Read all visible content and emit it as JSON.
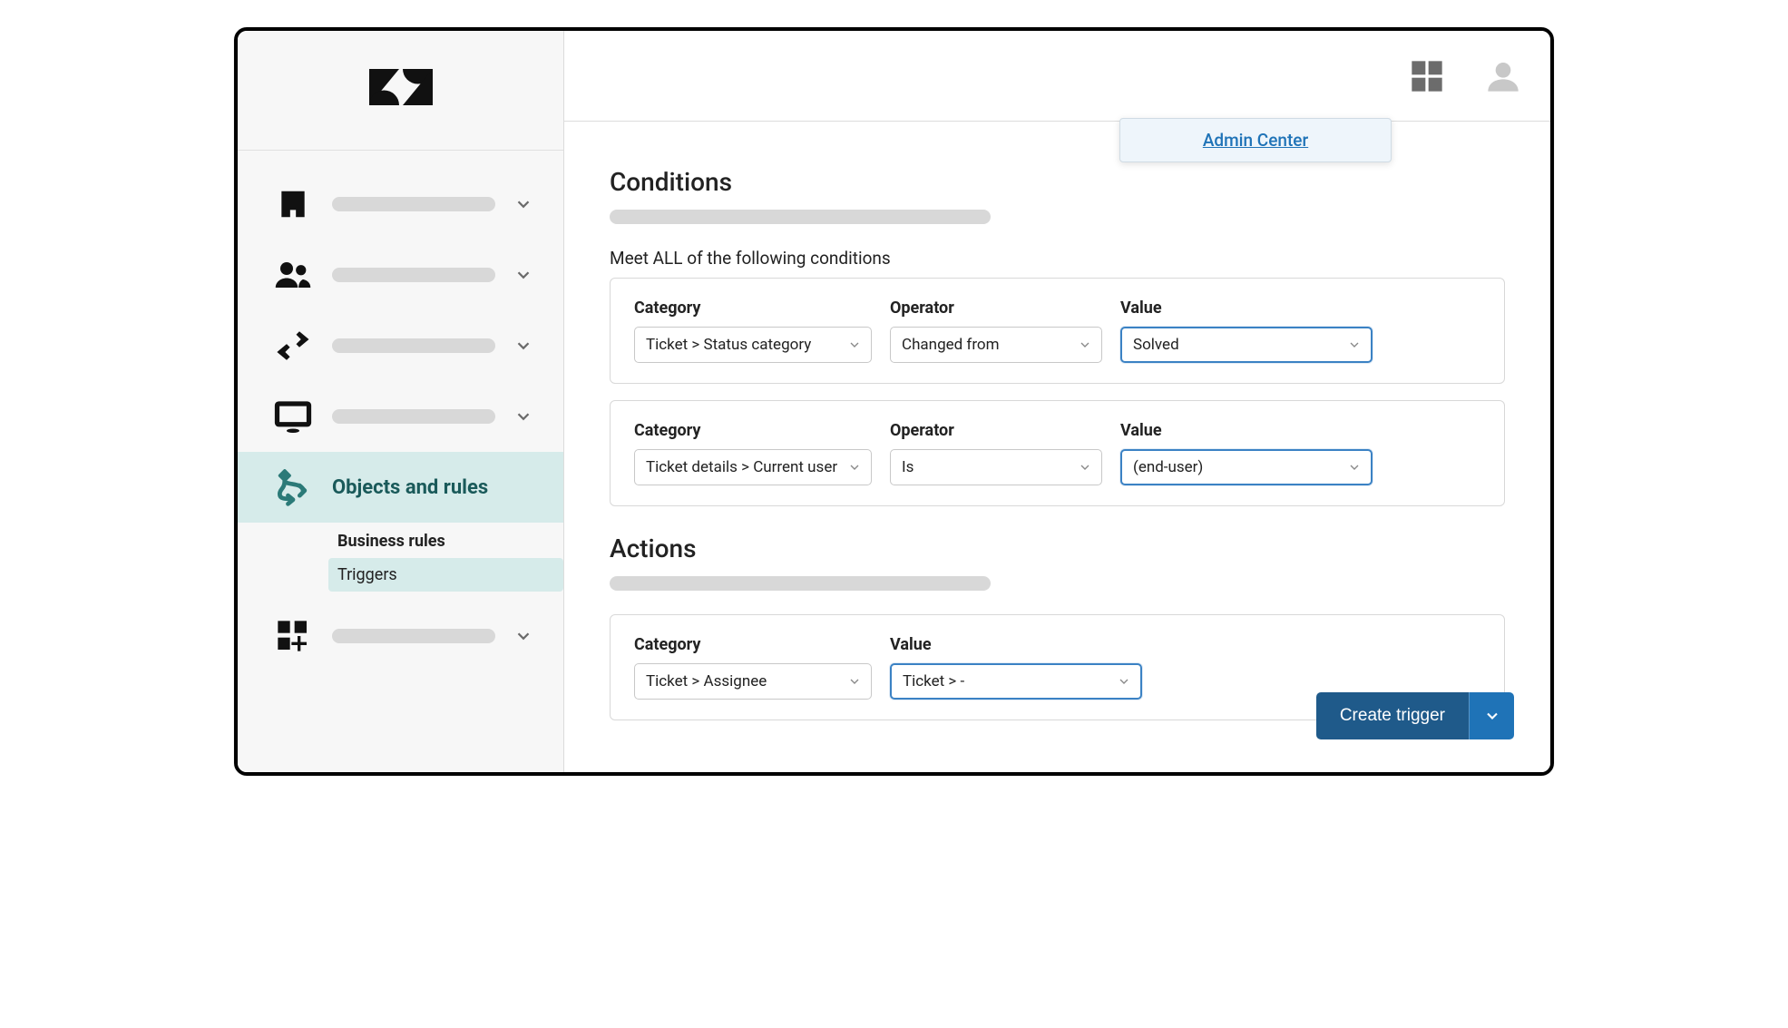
{
  "header": {
    "admin_center_label": "Admin Center"
  },
  "sidebar": {
    "active_label": "Objects and rules",
    "subnav": {
      "heading": "Business rules",
      "active_item": "Triggers"
    }
  },
  "conditions": {
    "title": "Conditions",
    "meet_all_label": "Meet ALL of the following conditions",
    "labels": {
      "category": "Category",
      "operator": "Operator",
      "value": "Value"
    },
    "rows": [
      {
        "category": "Ticket > Status category",
        "operator": "Changed from",
        "value": "Solved"
      },
      {
        "category": "Ticket details > Current user",
        "operator": "Is",
        "value": "(end-user)"
      }
    ]
  },
  "actions": {
    "title": "Actions",
    "labels": {
      "category": "Category",
      "value": "Value"
    },
    "rows": [
      {
        "category": "Ticket > Assignee",
        "value": "Ticket > -"
      }
    ]
  },
  "buttons": {
    "create_trigger": "Create trigger"
  }
}
